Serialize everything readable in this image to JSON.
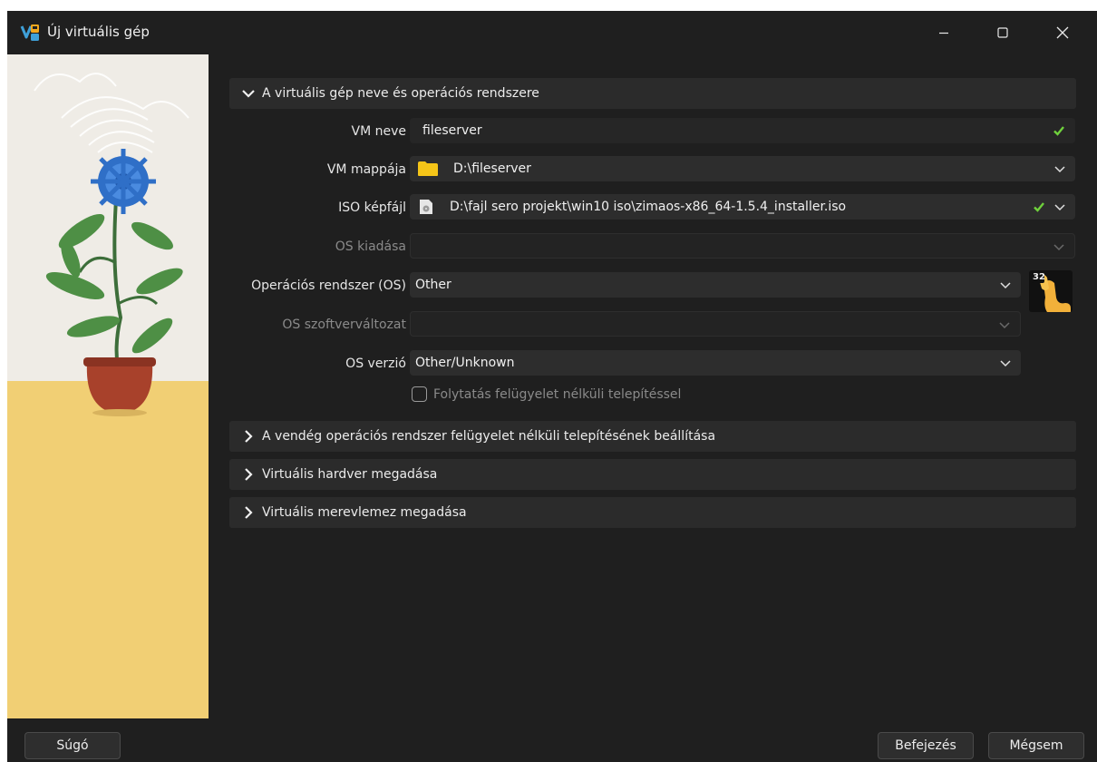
{
  "window": {
    "title": "Új virtuális gép"
  },
  "sections": {
    "name_os": {
      "title": "A virtuális gép neve és operációs rendszere",
      "expanded": true
    },
    "unattended": {
      "title": "A vendég operációs rendszer felügyelet nélküli telepítésének beállítása",
      "expanded": false
    },
    "hardware": {
      "title": "Virtuális hardver megadása",
      "expanded": false
    },
    "disk": {
      "title": "Virtuális merevlemez megadása",
      "expanded": false
    }
  },
  "form": {
    "vm_name": {
      "label": "VM neve",
      "value": "fileserver"
    },
    "vm_folder": {
      "label": "VM mappája",
      "value": "D:\\fileserver"
    },
    "iso": {
      "label": "ISO képfájl",
      "value": "D:\\fajl sero projekt\\win10 iso\\zimaos-x86_64-1.5.4_installer.iso"
    },
    "os_edition": {
      "label": "OS kiadása",
      "value": ""
    },
    "os_type": {
      "label": "Operációs rendszer (OS)",
      "value": "Other"
    },
    "os_subtype": {
      "label": "OS szoftverváltozat",
      "value": ""
    },
    "os_version": {
      "label": "OS verzió",
      "value": "Other/Unknown"
    },
    "unattended_checkbox": {
      "label": "Folytatás felügyelet nélküli telepítéssel",
      "checked": false
    }
  },
  "os_icon": {
    "badge": "32"
  },
  "buttons": {
    "help": "Súgó",
    "finish": "Befejezés",
    "cancel": "Mégsem"
  },
  "colors": {
    "check_green": "#6fd13c",
    "folder_yellow": "#f5c518",
    "sand": "#f1cf74"
  }
}
